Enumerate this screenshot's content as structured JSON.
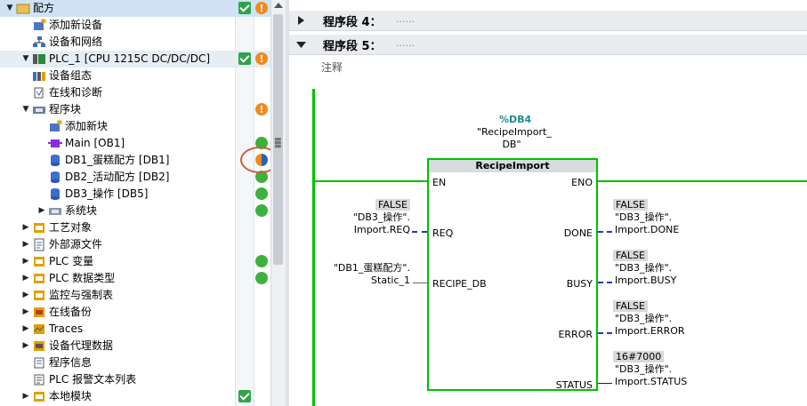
{
  "tree": {
    "items": [
      {
        "label": "配方",
        "level": 0,
        "expander": "▼",
        "icon": "folder-icon",
        "check": true,
        "status": "orange",
        "selected": true
      },
      {
        "label": "添加新设备",
        "level": 1,
        "expander": "",
        "icon": "add-device-icon"
      },
      {
        "label": "设备和网络",
        "level": 1,
        "expander": "",
        "icon": "network-icon"
      },
      {
        "label": "PLC_1 [CPU 1215C DC/DC/DC]",
        "level": 1,
        "expander": "▼",
        "icon": "plc-icon",
        "check": true,
        "status": "orange",
        "highlight": true
      },
      {
        "label": "设备组态",
        "level": 2,
        "expander": "",
        "icon": "device-config-icon"
      },
      {
        "label": "在线和诊断",
        "level": 2,
        "expander": "",
        "icon": "online-diagnostics-icon"
      },
      {
        "label": "程序块",
        "level": 2,
        "expander": "▼",
        "icon": "program-blocks-icon",
        "status": "orange"
      },
      {
        "label": "添加新块",
        "level": 3,
        "expander": "",
        "icon": "add-block-icon"
      },
      {
        "label": "Main [OB1]",
        "level": 3,
        "expander": "",
        "icon": "ob-icon",
        "status": "green"
      },
      {
        "label": "DB1_蛋糕配方 [DB1]",
        "level": 3,
        "expander": "",
        "icon": "db-icon",
        "status": "half"
      },
      {
        "label": "DB2_活动配方 [DB2]",
        "level": 3,
        "expander": "",
        "icon": "db-icon",
        "status": "green"
      },
      {
        "label": "DB3_操作 [DB5]",
        "level": 3,
        "expander": "",
        "icon": "db-icon",
        "status": "green"
      },
      {
        "label": "系统块",
        "level": 3,
        "expander": "▶",
        "icon": "system-blocks-icon",
        "status": "green"
      },
      {
        "label": "工艺对象",
        "level": 2,
        "expander": "▶",
        "icon": "technology-objects-icon"
      },
      {
        "label": "外部源文件",
        "level": 2,
        "expander": "▶",
        "icon": "external-source-icon"
      },
      {
        "label": "PLC 变量",
        "level": 2,
        "expander": "▶",
        "icon": "plc-tags-icon",
        "status": "green"
      },
      {
        "label": "PLC 数据类型",
        "level": 2,
        "expander": "▶",
        "icon": "plc-datatypes-icon",
        "status": "green"
      },
      {
        "label": "监控与强制表",
        "level": 2,
        "expander": "▶",
        "icon": "watch-table-icon"
      },
      {
        "label": "在线备份",
        "level": 2,
        "expander": "▶",
        "icon": "online-backup-icon"
      },
      {
        "label": "Traces",
        "level": 2,
        "expander": "▶",
        "icon": "traces-icon"
      },
      {
        "label": "设备代理数据",
        "level": 2,
        "expander": "▶",
        "icon": "device-proxy-icon"
      },
      {
        "label": "程序信息",
        "level": 2,
        "expander": "",
        "icon": "program-info-icon"
      },
      {
        "label": "PLC 报警文本列表",
        "level": 2,
        "expander": "",
        "icon": "alarm-text-icon"
      },
      {
        "label": "本地模块",
        "level": 2,
        "expander": "▶",
        "icon": "local-modules-icon",
        "check": true
      }
    ]
  },
  "editor": {
    "network4": {
      "title": "程序段 4：",
      "dots": "......"
    },
    "network5": {
      "title": "程序段 5：",
      "dots": "......"
    },
    "comment": "注释",
    "instance": {
      "db": "%DB4",
      "name_line1": "\"RecipeImport_",
      "name_line2": "DB\""
    },
    "block": {
      "type": "RecipeImport",
      "inputs": {
        "en": "EN",
        "req": "REQ",
        "recipe_db": "RECIPE_DB"
      },
      "outputs": {
        "eno": "ENO",
        "done": "DONE",
        "busy": "BUSY",
        "error": "ERROR",
        "status": "STATUS"
      }
    },
    "req_param": {
      "value": "FALSE",
      "line1": "\"DB3_操作\".",
      "line2": "Import.REQ"
    },
    "recipe_param": {
      "line1": "\"DB1_蛋糕配方\".",
      "line2": "Static_1"
    },
    "done_param": {
      "value": "FALSE",
      "line1": "\"DB3_操作\".",
      "line2": "Import.DONE"
    },
    "busy_param": {
      "value": "FALSE",
      "line1": "\"DB3_操作\".",
      "line2": "Import.BUSY"
    },
    "error_param": {
      "value": "FALSE",
      "line1": "\"DB3_操作\".",
      "line2": "Import.ERROR"
    },
    "status_param": {
      "value": "16#7000",
      "line1": "\"DB3_操作\".",
      "line2": "Import.STATUS"
    }
  },
  "colors": {
    "accent_green": "#00c000",
    "wire_blue": "#1c3fa6",
    "status_green": "#3db13d",
    "status_orange": "#f08a1c",
    "highlight_circle": "#c9613a"
  }
}
